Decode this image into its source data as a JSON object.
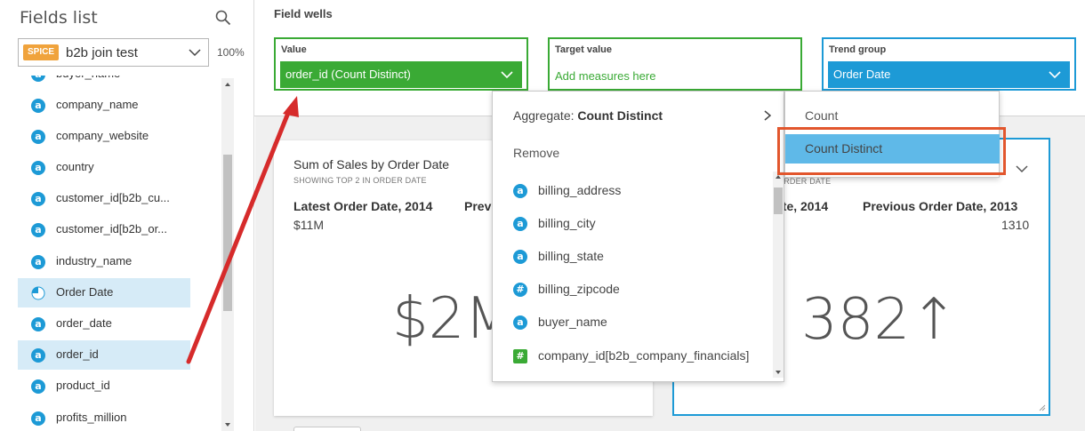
{
  "left_panel": {
    "title": "Fields list",
    "dataset": {
      "badge": "SPICE",
      "name": "b2b join test",
      "percent": "100%"
    },
    "fields": [
      {
        "label": "buyer_name",
        "icon": "a",
        "selected": false
      },
      {
        "label": "company_name",
        "icon": "a",
        "selected": false
      },
      {
        "label": "company_website",
        "icon": "a",
        "selected": false
      },
      {
        "label": "country",
        "icon": "a",
        "selected": false
      },
      {
        "label": "customer_id[b2b_cu...",
        "icon": "a",
        "selected": false
      },
      {
        "label": "customer_id[b2b_or...",
        "icon": "a",
        "selected": false
      },
      {
        "label": "industry_name",
        "icon": "a",
        "selected": false
      },
      {
        "label": "Order Date",
        "icon": "clock",
        "selected": true
      },
      {
        "label": "order_date",
        "icon": "a",
        "selected": false
      },
      {
        "label": "order_id",
        "icon": "a",
        "selected": true
      },
      {
        "label": "product_id",
        "icon": "a",
        "selected": false
      },
      {
        "label": "profits_million",
        "icon": "a",
        "selected": false
      }
    ]
  },
  "wells": {
    "title": "Field wells",
    "value": {
      "label": "Value",
      "pill": "order_id (Count Distinct)"
    },
    "target": {
      "label": "Target value",
      "placeholder": "Add measures here"
    },
    "trend": {
      "label": "Trend group",
      "pill": "Order Date"
    }
  },
  "card_left": {
    "title": "Sum of Sales by Order Date",
    "subtitle": "SHOWING TOP 2 IN ORDER DATE",
    "latest_label": "Latest Order Date, 2014",
    "previous_label": "Previ",
    "latest_value": "$11M",
    "big_number": "$2M"
  },
  "card_right": {
    "subtitle": "ORDER DATE",
    "latest_label": "ate, 2014",
    "previous_label": "Previous Order Date, 2013",
    "previous_value": "1310",
    "big_number": "382↑"
  },
  "menu": {
    "aggregate_prefix": "Aggregate: ",
    "aggregate_value": "Count Distinct",
    "remove": "Remove",
    "fields": [
      {
        "label": "billing_address",
        "icon": "a"
      },
      {
        "label": "billing_city",
        "icon": "a"
      },
      {
        "label": "billing_state",
        "icon": "a"
      },
      {
        "label": "billing_zipcode",
        "icon": "#"
      },
      {
        "label": "buyer_name",
        "icon": "a"
      },
      {
        "label": "company_id[b2b_company_financials]",
        "icon": "#"
      }
    ]
  },
  "submenu": {
    "options": [
      "Count",
      "Count Distinct"
    ],
    "selected": "Count Distinct"
  },
  "colors": {
    "green": "#3aaa35",
    "blue": "#1d9ad6",
    "highlight": "#5fb9e8",
    "annotation": "#e2562d",
    "arrow": "#d62b2b"
  }
}
